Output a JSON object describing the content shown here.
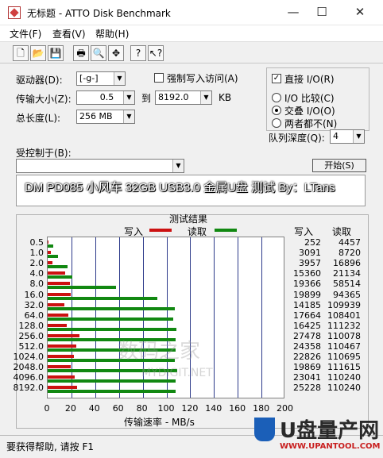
{
  "window": {
    "title": "无标题 - ATTO Disk Benchmark",
    "minimize": "—",
    "maximize": "☐",
    "close": "✕"
  },
  "menu": [
    "文件(F)",
    "查看(V)",
    "帮助(H)"
  ],
  "toolbar_icons": [
    "new-file-icon",
    "open-folder-icon",
    "save-icon",
    "print-icon",
    "print-preview-icon",
    "move-icon",
    "help-icon",
    "context-help-icon"
  ],
  "form": {
    "drive_label": "驱动器(D):",
    "drive_value": "[-g-]",
    "force_write_label": "强制写入访问(A)",
    "transfer_label": "传输大小(Z):",
    "transfer_from": "0.5",
    "to_label": "到",
    "transfer_to": "8192.0",
    "kb_label": "KB",
    "length_label": "总长度(L):",
    "length_value": "256 MB",
    "direct_io_label": "直接 I/O(R)",
    "io_compare_label": "I/O 比较(C)",
    "overlapped_io_label": "交叠 I/O(O)",
    "neither_label": "两者都不(N)",
    "queue_label": "队列深度(Q):",
    "queue_value": "4",
    "controlled_label": "受控制于(B):",
    "controlled_value": "",
    "start_button": "开始(S)",
    "description": "DM PD085 小风车 32GB USB3.0 金属U盘 测试 By：LTans"
  },
  "results": {
    "title": "测试结果",
    "legend_write": "写入",
    "legend_read": "读取",
    "col_write": "写入",
    "col_read": "读取"
  },
  "chart_data": {
    "type": "bar",
    "orientation": "horizontal",
    "title": "测试结果",
    "xlabel": "传输速率 - MB/s",
    "xlim": [
      0,
      200
    ],
    "xticks": [
      "0",
      "20",
      "40",
      "60",
      "80",
      "100",
      "120",
      "140",
      "160",
      "180",
      "200"
    ],
    "grid": true,
    "legend_placement": "top",
    "categories": [
      "0.5",
      "1.0",
      "2.0",
      "4.0",
      "8.0",
      "16.0",
      "32.0",
      "64.0",
      "128.0",
      "256.0",
      "512.0",
      "1024.0",
      "2048.0",
      "4096.0",
      "8192.0"
    ],
    "series": [
      {
        "name": "写入",
        "color": "#cc1111",
        "values": [
          0.25,
          3.0,
          3.9,
          15.0,
          18.9,
          19.4,
          13.9,
          17.3,
          16.0,
          26.8,
          23.8,
          22.3,
          19.4,
          22.5,
          24.6
        ]
      },
      {
        "name": "读取",
        "color": "#118811",
        "values": [
          4.4,
          8.5,
          16.5,
          20.6,
          57.2,
          92.1,
          107.3,
          105.9,
          108.6,
          107.5,
          107.9,
          107.0,
          109.0,
          107.6,
          107.7
        ]
      }
    ],
    "table_write": [
      "252",
      "3091",
      "3957",
      "15360",
      "19366",
      "19899",
      "14185",
      "17664",
      "16425",
      "27478",
      "24358",
      "22826",
      "19869",
      "23041",
      "25228"
    ],
    "table_read": [
      "4457",
      "8720",
      "16896",
      "21134",
      "58514",
      "94365",
      "109939",
      "108401",
      "111232",
      "110078",
      "110467",
      "110695",
      "111615",
      "110240",
      "110240"
    ]
  },
  "status": "要获得帮助, 请按 F1",
  "watermarks": {
    "center_cn": "数码之家",
    "center_en": "MYDIGIT.NET",
    "corner_cn": "U盘量产网",
    "corner_url": "WWW.UPANTOOL.COM"
  },
  "colors": {
    "write": "#cc1111",
    "read": "#118811",
    "grid": "#2d3a8a"
  }
}
